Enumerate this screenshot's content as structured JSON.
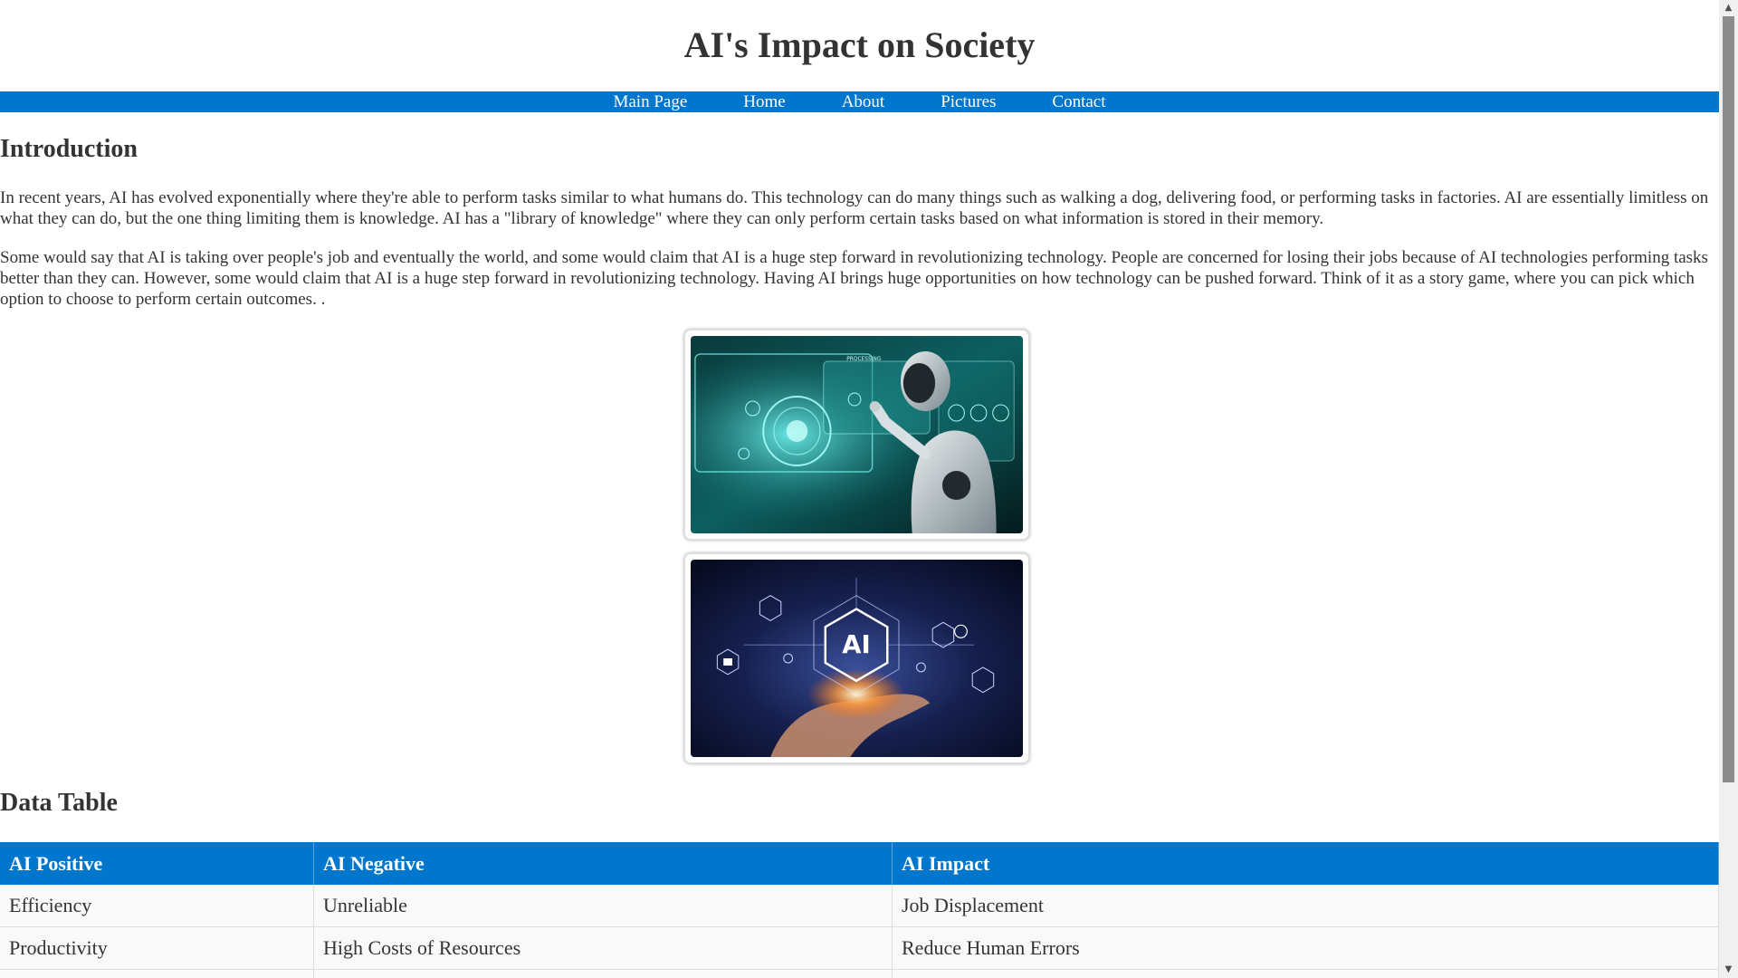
{
  "header": {
    "title": "AI's Impact on Society"
  },
  "nav": {
    "items": [
      "Main Page",
      "Home",
      "About",
      "Pictures",
      "Contact"
    ]
  },
  "intro": {
    "heading": "Introduction",
    "paragraphs": [
      "In recent years, AI has evolved exponentially where they're able to perform tasks similar to what humans do. This technology can do many things such as walking a dog, delivering food, or performing tasks in factories. AI are essentially limitless on what they can do, but the one thing limiting them is knowledge. AI has a \"library of knowledge\" where they can only perform certain tasks based on what information is stored in their memory.",
      "Some would say that AI is taking over people's job and eventually the world, and some would claim that AI is a huge step forward in revolutionizing technology. People are concerned for losing their jobs because of AI technologies performing tasks better than they can. However, some would claim that AI is a huge step forward in revolutionizing technology. Having AI brings huge opportunities on how technology can be pushed forward. Think of it as a story game, where you can pick which option to choose to perform certain outcomes. ."
    ]
  },
  "images": {
    "image_1_text": "PROCESSING",
    "image_2_text": "AI"
  },
  "data_table": {
    "heading": "Data Table",
    "headers": [
      "AI Positive",
      "AI Negative",
      "AI Impact"
    ],
    "rows": [
      [
        "Efficiency",
        "Unreliable",
        "Job Displacement"
      ],
      [
        "Productivity",
        "High Costs of Resources",
        "Reduce Human Errors"
      ],
      [
        "",
        "",
        ""
      ]
    ]
  },
  "colors": {
    "accent": "#0077cc",
    "text": "#333333",
    "row_background": "#f9f9f9"
  },
  "icons": {
    "scroll_up": "scroll-up-arrow-icon",
    "scroll_down": "scroll-down-arrow-icon"
  }
}
